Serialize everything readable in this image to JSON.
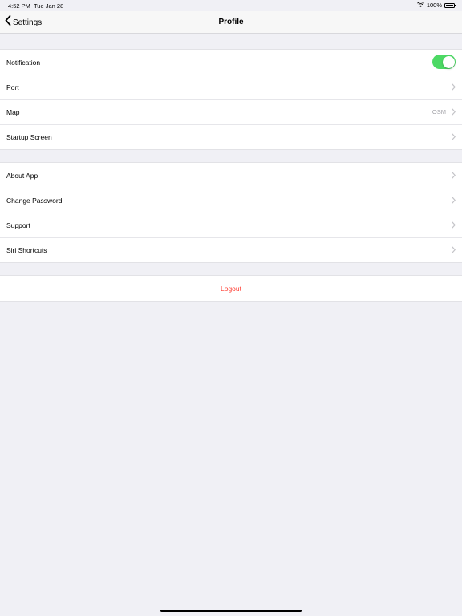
{
  "status_bar": {
    "time": "4:52 PM",
    "date": "Tue Jan 28",
    "battery": "100%",
    "battery_level": 1.0
  },
  "nav": {
    "back_label": "Settings",
    "title": "Profile"
  },
  "settings_group": {
    "notification_label": "Notification",
    "notification_on": true,
    "port_label": "Port",
    "map_label": "Map",
    "map_value": "OSM",
    "startup_label": "Startup Screen"
  },
  "info_group": {
    "about_label": "About App",
    "password_label": "Change Password",
    "support_label": "Support",
    "siri_label": "Siri Shortcuts"
  },
  "logout": {
    "label": "Logout"
  },
  "colors": {
    "toggle_on": "#4cd964",
    "destructive": "#ff3b30",
    "background": "#f0f0f5"
  }
}
